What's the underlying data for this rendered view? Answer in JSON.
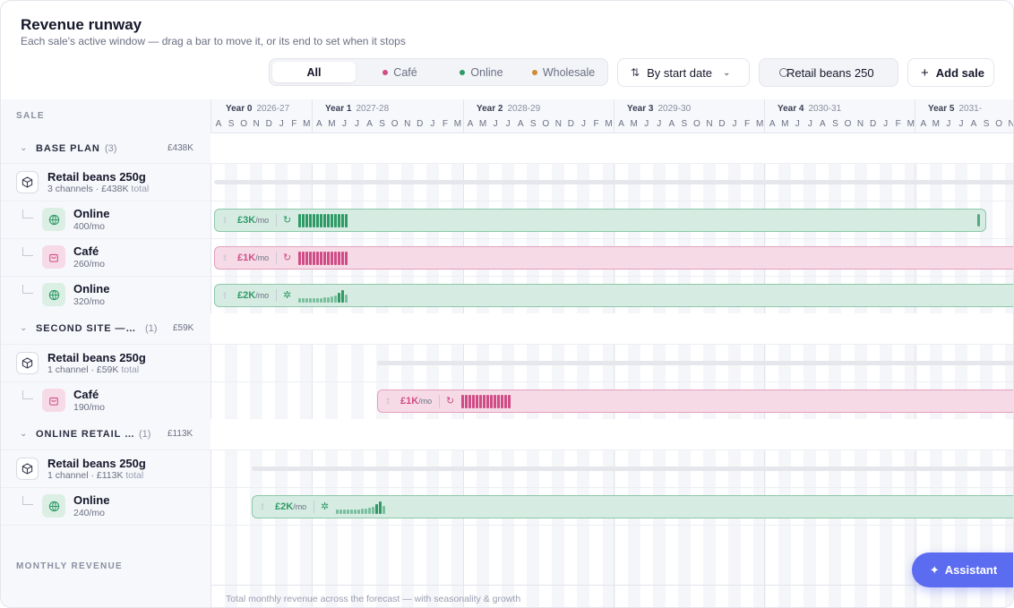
{
  "header": {
    "title": "Revenue runway",
    "subtitle": "Each sale's active window — drag a bar to move it, or its end to set when it stops"
  },
  "filters": {
    "all": "All",
    "cafe": "Café",
    "online": "Online",
    "wholesale": "Wholesale",
    "colors": {
      "cafe": "#d04c86",
      "online": "#2f9a66",
      "wholesale": "#d08a33"
    }
  },
  "sort": {
    "label": "By start date"
  },
  "search": {
    "value": "Retail beans 250"
  },
  "add_sale": {
    "label": "Add sale"
  },
  "sidebar": {
    "header": "SALE"
  },
  "timeline": {
    "years": [
      {
        "label": "Year 0",
        "range": "2026-27"
      },
      {
        "label": "Year 1",
        "range": "2027-28"
      },
      {
        "label": "Year 2",
        "range": "2028-29"
      },
      {
        "label": "Year 3",
        "range": "2029-30"
      },
      {
        "label": "Year 4",
        "range": "2030-31"
      },
      {
        "label": "Year 5",
        "range": "2031-"
      }
    ],
    "months": [
      "A",
      "S",
      "O",
      "N",
      "D",
      "J",
      "F",
      "M",
      "A",
      "M",
      "J",
      "J",
      "A",
      "S",
      "O",
      "N",
      "D",
      "J",
      "F",
      "M",
      "A",
      "M",
      "J",
      "J",
      "A",
      "S",
      "O",
      "N",
      "D",
      "J",
      "F",
      "M",
      "A",
      "M",
      "J",
      "J",
      "A",
      "S",
      "O",
      "N",
      "D",
      "J",
      "F",
      "M",
      "A",
      "M",
      "J",
      "J",
      "A",
      "S",
      "O",
      "N",
      "D",
      "J",
      "F",
      "M",
      "A",
      "M",
      "J",
      "J",
      "A",
      "S",
      "O",
      "N"
    ]
  },
  "groups": [
    {
      "title": "BASE PLAN",
      "count": "(3)",
      "total": "£438K",
      "product": {
        "name": "Retail beans 250g",
        "channels": "3 channels · £438K",
        "total_word": "total"
      },
      "rows": [
        {
          "name": "Online",
          "rate": "400/mo",
          "value": "£3K",
          "unit": "/mo",
          "color": "green",
          "mode": "↻"
        },
        {
          "name": "Café",
          "rate": "260/mo",
          "value": "£1K",
          "unit": "/mo",
          "color": "pink",
          "mode": "↻"
        },
        {
          "name": "Online",
          "rate": "320/mo",
          "value": "£2K",
          "unit": "/mo",
          "color": "green",
          "mode": "✲"
        }
      ]
    },
    {
      "title": "SECOND SITE — …",
      "count": "(1)",
      "total": "£59K",
      "product": {
        "name": "Retail beans 250g",
        "channels": "1 channel · £59K",
        "total_word": "total"
      },
      "rows": [
        {
          "name": "Café",
          "rate": "190/mo",
          "value": "£1K",
          "unit": "/mo",
          "color": "pink",
          "mode": "↻"
        }
      ]
    },
    {
      "title": "ONLINE RETAIL …",
      "count": "(1)",
      "total": "£113K",
      "product": {
        "name": "Retail beans 250g",
        "channels": "1 channel · £113K",
        "total_word": "total"
      },
      "rows": [
        {
          "name": "Online",
          "rate": "240/mo",
          "value": "£2K",
          "unit": "/mo",
          "color": "green",
          "mode": "✲"
        }
      ]
    }
  ],
  "monthly_revenue": {
    "label": "MONTHLY REVENUE",
    "caption": "Total monthly revenue across the forecast — with seasonality & growth"
  },
  "assistant": {
    "label": "Assistant"
  }
}
